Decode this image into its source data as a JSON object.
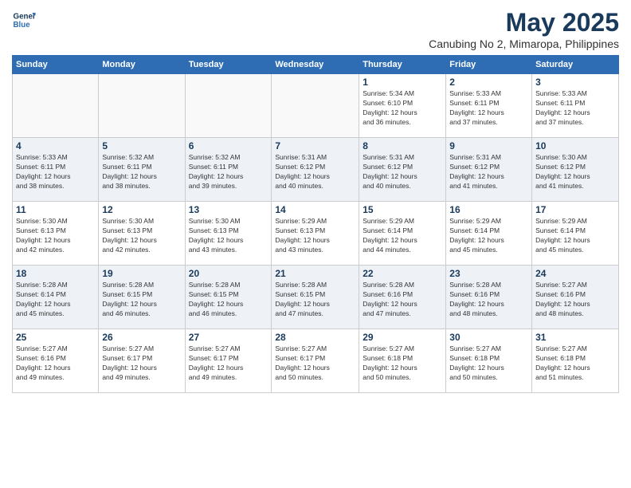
{
  "logo": {
    "line1": "General",
    "line2": "Blue"
  },
  "title": "May 2025",
  "subtitle": "Canubing No 2, Mimaropa, Philippines",
  "weekdays": [
    "Sunday",
    "Monday",
    "Tuesday",
    "Wednesday",
    "Thursday",
    "Friday",
    "Saturday"
  ],
  "rows": [
    [
      {
        "day": "",
        "info": ""
      },
      {
        "day": "",
        "info": ""
      },
      {
        "day": "",
        "info": ""
      },
      {
        "day": "",
        "info": ""
      },
      {
        "day": "1",
        "info": "Sunrise: 5:34 AM\nSunset: 6:10 PM\nDaylight: 12 hours\nand 36 minutes."
      },
      {
        "day": "2",
        "info": "Sunrise: 5:33 AM\nSunset: 6:11 PM\nDaylight: 12 hours\nand 37 minutes."
      },
      {
        "day": "3",
        "info": "Sunrise: 5:33 AM\nSunset: 6:11 PM\nDaylight: 12 hours\nand 37 minutes."
      }
    ],
    [
      {
        "day": "4",
        "info": "Sunrise: 5:33 AM\nSunset: 6:11 PM\nDaylight: 12 hours\nand 38 minutes."
      },
      {
        "day": "5",
        "info": "Sunrise: 5:32 AM\nSunset: 6:11 PM\nDaylight: 12 hours\nand 38 minutes."
      },
      {
        "day": "6",
        "info": "Sunrise: 5:32 AM\nSunset: 6:11 PM\nDaylight: 12 hours\nand 39 minutes."
      },
      {
        "day": "7",
        "info": "Sunrise: 5:31 AM\nSunset: 6:12 PM\nDaylight: 12 hours\nand 40 minutes."
      },
      {
        "day": "8",
        "info": "Sunrise: 5:31 AM\nSunset: 6:12 PM\nDaylight: 12 hours\nand 40 minutes."
      },
      {
        "day": "9",
        "info": "Sunrise: 5:31 AM\nSunset: 6:12 PM\nDaylight: 12 hours\nand 41 minutes."
      },
      {
        "day": "10",
        "info": "Sunrise: 5:30 AM\nSunset: 6:12 PM\nDaylight: 12 hours\nand 41 minutes."
      }
    ],
    [
      {
        "day": "11",
        "info": "Sunrise: 5:30 AM\nSunset: 6:13 PM\nDaylight: 12 hours\nand 42 minutes."
      },
      {
        "day": "12",
        "info": "Sunrise: 5:30 AM\nSunset: 6:13 PM\nDaylight: 12 hours\nand 42 minutes."
      },
      {
        "day": "13",
        "info": "Sunrise: 5:30 AM\nSunset: 6:13 PM\nDaylight: 12 hours\nand 43 minutes."
      },
      {
        "day": "14",
        "info": "Sunrise: 5:29 AM\nSunset: 6:13 PM\nDaylight: 12 hours\nand 43 minutes."
      },
      {
        "day": "15",
        "info": "Sunrise: 5:29 AM\nSunset: 6:14 PM\nDaylight: 12 hours\nand 44 minutes."
      },
      {
        "day": "16",
        "info": "Sunrise: 5:29 AM\nSunset: 6:14 PM\nDaylight: 12 hours\nand 45 minutes."
      },
      {
        "day": "17",
        "info": "Sunrise: 5:29 AM\nSunset: 6:14 PM\nDaylight: 12 hours\nand 45 minutes."
      }
    ],
    [
      {
        "day": "18",
        "info": "Sunrise: 5:28 AM\nSunset: 6:14 PM\nDaylight: 12 hours\nand 45 minutes."
      },
      {
        "day": "19",
        "info": "Sunrise: 5:28 AM\nSunset: 6:15 PM\nDaylight: 12 hours\nand 46 minutes."
      },
      {
        "day": "20",
        "info": "Sunrise: 5:28 AM\nSunset: 6:15 PM\nDaylight: 12 hours\nand 46 minutes."
      },
      {
        "day": "21",
        "info": "Sunrise: 5:28 AM\nSunset: 6:15 PM\nDaylight: 12 hours\nand 47 minutes."
      },
      {
        "day": "22",
        "info": "Sunrise: 5:28 AM\nSunset: 6:16 PM\nDaylight: 12 hours\nand 47 minutes."
      },
      {
        "day": "23",
        "info": "Sunrise: 5:28 AM\nSunset: 6:16 PM\nDaylight: 12 hours\nand 48 minutes."
      },
      {
        "day": "24",
        "info": "Sunrise: 5:27 AM\nSunset: 6:16 PM\nDaylight: 12 hours\nand 48 minutes."
      }
    ],
    [
      {
        "day": "25",
        "info": "Sunrise: 5:27 AM\nSunset: 6:16 PM\nDaylight: 12 hours\nand 49 minutes."
      },
      {
        "day": "26",
        "info": "Sunrise: 5:27 AM\nSunset: 6:17 PM\nDaylight: 12 hours\nand 49 minutes."
      },
      {
        "day": "27",
        "info": "Sunrise: 5:27 AM\nSunset: 6:17 PM\nDaylight: 12 hours\nand 49 minutes."
      },
      {
        "day": "28",
        "info": "Sunrise: 5:27 AM\nSunset: 6:17 PM\nDaylight: 12 hours\nand 50 minutes."
      },
      {
        "day": "29",
        "info": "Sunrise: 5:27 AM\nSunset: 6:18 PM\nDaylight: 12 hours\nand 50 minutes."
      },
      {
        "day": "30",
        "info": "Sunrise: 5:27 AM\nSunset: 6:18 PM\nDaylight: 12 hours\nand 50 minutes."
      },
      {
        "day": "31",
        "info": "Sunrise: 5:27 AM\nSunset: 6:18 PM\nDaylight: 12 hours\nand 51 minutes."
      }
    ]
  ]
}
